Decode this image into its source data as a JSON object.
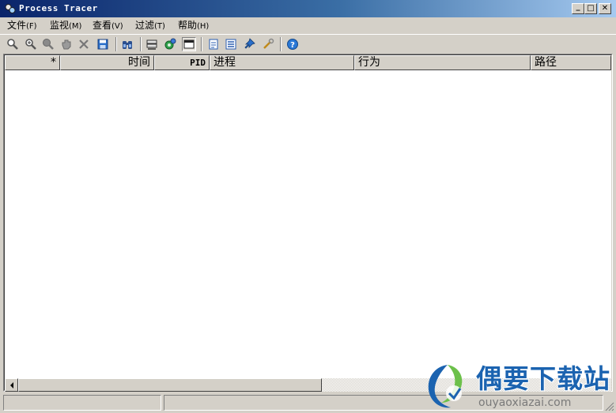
{
  "window": {
    "title": "Process Tracer",
    "minimize": "_",
    "maximize": "□",
    "close": "✕"
  },
  "menu": [
    {
      "label": "文件",
      "accel": "(F)"
    },
    {
      "label": "监视",
      "accel": "(M)"
    },
    {
      "label": "查看",
      "accel": "(V)"
    },
    {
      "label": "过滤",
      "accel": "(T)"
    },
    {
      "label": "帮助",
      "accel": "(H)"
    }
  ],
  "toolbar": {
    "icons": [
      "search-icon",
      "zoom-in-icon",
      "search-dim-icon",
      "hand-icon",
      "delete-icon",
      "save-icon",
      "find-icon",
      "filter-icon",
      "process-icon",
      "window-view-icon",
      "document-icon",
      "list-icon",
      "pin-icon",
      "tools-icon",
      "help-icon"
    ],
    "pressed": "window-view-icon"
  },
  "table": {
    "columns": [
      "*",
      "时间",
      "PID",
      "进程",
      "行为",
      "路径"
    ],
    "rows": []
  },
  "watermark": {
    "title": "偶要下载站",
    "url": "ouyaoxiazai.com"
  },
  "colors": {
    "titlebar_start": "#0a246a",
    "titlebar_end": "#a6caf0",
    "chrome": "#d4d0c8",
    "watermark_blue": "#1b63b0"
  }
}
